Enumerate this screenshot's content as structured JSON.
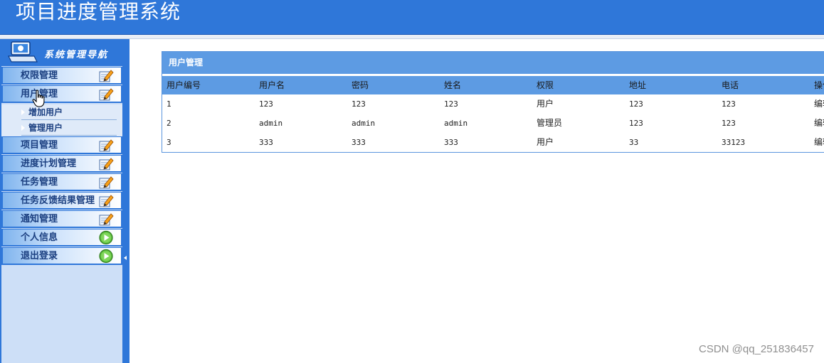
{
  "header": {
    "title": "项目进度管理系统"
  },
  "sidebar": {
    "nav_title": "系统管理导航",
    "items": [
      {
        "label": "权限管理",
        "icon": "edit-note-icon"
      },
      {
        "label": "用户管理",
        "icon": "edit-note-icon"
      },
      {
        "label": "项目管理",
        "icon": "edit-note-icon"
      },
      {
        "label": "进度计划管理",
        "icon": "edit-note-icon"
      },
      {
        "label": "任务管理",
        "icon": "edit-note-icon"
      },
      {
        "label": "任务反馈结果管理",
        "icon": "edit-note-icon"
      },
      {
        "label": "通知管理",
        "icon": "edit-note-icon"
      },
      {
        "label": "个人信息",
        "icon": "play-circle-icon"
      },
      {
        "label": "退出登录",
        "icon": "play-circle-icon"
      }
    ],
    "submenu": [
      {
        "label": "增加用户"
      },
      {
        "label": "管理用户"
      }
    ]
  },
  "panel": {
    "title": "用户管理",
    "columns": [
      "用户编号",
      "用户名",
      "密码",
      "姓名",
      "权限",
      "地址",
      "电话",
      "操作"
    ],
    "rows": [
      [
        "1",
        "123",
        "123",
        "123",
        "用户",
        "123",
        "123",
        "编辑"
      ],
      [
        "2",
        "admin",
        "admin",
        "admin",
        "管理员",
        "123",
        "123",
        "编辑"
      ],
      [
        "3",
        "333",
        "333",
        "333",
        "用户",
        "33",
        "33123",
        "编辑"
      ]
    ]
  },
  "watermark": "CSDN @qq_251836457",
  "colors": {
    "accent": "#2f77d9",
    "panel_header": "#5d9be3",
    "sidebar_bg": "#cddff7"
  }
}
